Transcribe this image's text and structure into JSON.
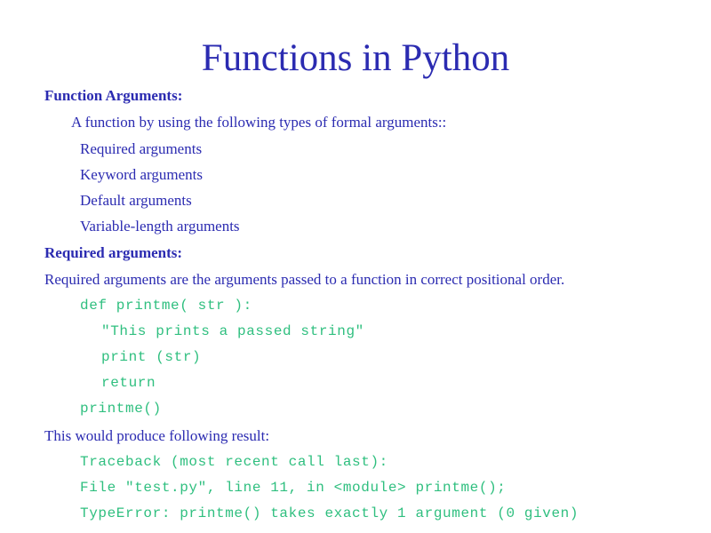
{
  "title": "Functions in Python",
  "section1": {
    "heading": "Function Arguments:",
    "intro": "A function by using the following types of formal arguments::",
    "types": [
      "Required arguments",
      "Keyword arguments",
      "Default arguments",
      "Variable-length arguments"
    ]
  },
  "section2": {
    "heading": "Required arguments:",
    "description": "Required arguments are the arguments passed to a function in correct positional order.",
    "code": [
      "def printme( str ):",
      "\"This prints a passed string\"",
      "print (str)",
      "return",
      "printme()"
    ],
    "result_intro": "This would produce following result:",
    "output": [
      "Traceback (most recent call last):",
      "File \"test.py\", line 11, in <module> printme();",
      "TypeError: printme() takes exactly 1 argument (0 given)"
    ]
  },
  "colors": {
    "text": "#2b2bb1",
    "code": "#2fbf7f",
    "background": "#ffffff"
  }
}
